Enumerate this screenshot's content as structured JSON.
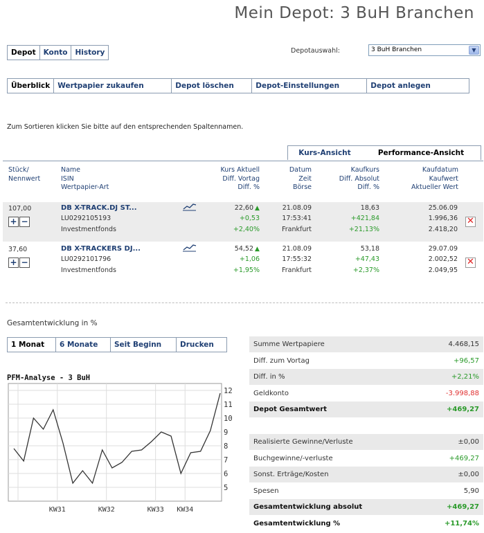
{
  "page": {
    "title": "Mein Depot: 3 BuH Branchen"
  },
  "main_tabs": [
    "Depot",
    "Konto",
    "History"
  ],
  "depot_select": {
    "label": "Depotauswahl:",
    "value": "3 BuH Branchen"
  },
  "sub_tabs": [
    "Überblick",
    "Wertpapier zukaufen",
    "Depot löschen",
    "Depot-Einstellungen",
    "Depot anlegen"
  ],
  "sort_hint": "Zum Sortieren klicken Sie bitte auf den entsprechenden Spaltennamen.",
  "view_tabs": [
    "Kurs-Ansicht",
    "Performance-Ansicht"
  ],
  "table_headers": {
    "col1": [
      "Stück/",
      "Nennwert"
    ],
    "col2": [
      "Name",
      "ISIN",
      "Wertpapier-Art"
    ],
    "col3": [
      "Kurs Aktuell",
      "Diff. Vortag",
      "Diff. %"
    ],
    "col4": [
      "Datum",
      "Zeit",
      "Börse"
    ],
    "col5": [
      "Kaufkurs",
      "Diff. Absolut",
      "Diff. %"
    ],
    "col6": [
      "Kaufdatum",
      "Kaufwert",
      "Aktueller Wert"
    ]
  },
  "holdings": [
    {
      "qty": "107,00",
      "name": "DB X-TRACK.DJ ST...",
      "isin": "LU0292105193",
      "type": "Investmentfonds",
      "kurs": "22,60",
      "diff_vortag": "+0,53",
      "diff_pct": "+2,40%",
      "datum": "21.08.09",
      "zeit": "17:53:41",
      "boerse": "Frankfurt",
      "kaufkurs": "18,63",
      "diff_abs": "+421,84",
      "diff_abs_pct": "+21,13%",
      "kaufdatum": "25.06.09",
      "kaufwert": "1.996,36",
      "akt_wert": "2.418,20"
    },
    {
      "qty": "37,60",
      "name": "DB X-TRACKERS DJ...",
      "isin": "LU0292101796",
      "type": "Investmentfonds",
      "kurs": "54,52",
      "diff_vortag": "+1,06",
      "diff_pct": "+1,95%",
      "datum": "21.08.09",
      "zeit": "17:55:32",
      "boerse": "Frankfurt",
      "kaufkurs": "53,18",
      "diff_abs": "+47,43",
      "diff_abs_pct": "+2,37%",
      "kaufdatum": "29.07.09",
      "kaufwert": "2.002,52",
      "akt_wert": "2.049,95"
    }
  ],
  "perf_section": {
    "title": "Gesamtentwicklung in %",
    "tabs": [
      "1 Monat",
      "6 Monate",
      "Seit Beginn",
      "Drucken"
    ]
  },
  "chart_data": {
    "type": "line",
    "title": "PFM-Analyse - 3 BuH",
    "x_ticks": [
      "KW31",
      "KW32",
      "KW33",
      "KW34"
    ],
    "y_ticks": [
      "5",
      "6",
      "7",
      "8",
      "9",
      "10",
      "11",
      "12"
    ],
    "ylim": [
      4,
      12.5
    ],
    "y_axis_position": "right",
    "grid": true,
    "values": [
      7.8,
      6.9,
      10.0,
      9.2,
      10.6,
      8.2,
      5.3,
      6.2,
      5.3,
      7.7,
      6.4,
      6.8,
      7.6,
      7.7,
      8.3,
      9.0,
      8.7,
      6.0,
      7.5,
      7.6,
      9.1,
      11.8
    ]
  },
  "summary": [
    {
      "key": "Summe Wertpapiere",
      "value": "4.468,15",
      "tone": "normal",
      "shade": true
    },
    {
      "key": "Diff. zum Vortag",
      "value": "+96,57",
      "tone": "pos",
      "shade": false
    },
    {
      "key": "Diff. in %",
      "value": "+2,21%",
      "tone": "pos",
      "shade": true
    },
    {
      "key": "Geldkonto",
      "value": "-3.998,88",
      "tone": "neg",
      "shade": false
    },
    {
      "key": "Depot Gesamtwert",
      "value": "+469,27",
      "tone": "pos",
      "bold": true,
      "shade": true
    }
  ],
  "summary2": [
    {
      "key": "Realisierte Gewinne/Verluste",
      "value": "±0,00",
      "tone": "normal",
      "shade": true
    },
    {
      "key": "Buchgewinne/-verluste",
      "value": "+469,27",
      "tone": "pos",
      "shade": false
    },
    {
      "key": "Sonst. Erträge/Kosten",
      "value": "±0,00",
      "tone": "normal",
      "shade": true
    },
    {
      "key": "Spesen",
      "value": "5,90",
      "tone": "normal",
      "shade": false
    },
    {
      "key": "Gesamtentwicklung absolut",
      "value": "+469,27",
      "tone": "pos",
      "bold": true,
      "shade": true
    },
    {
      "key": "Gesamtentwicklung %",
      "value": "+11,74%",
      "tone": "pos",
      "bold": true,
      "shade": false
    }
  ],
  "colors": {
    "link": "#1f3f73",
    "pos": "#2a9a2a",
    "neg": "#e03030"
  },
  "icons": {
    "plus": "+",
    "minus": "−",
    "delete": "✕",
    "chart": "chart-icon",
    "trend_up": "arrow-up-icon"
  }
}
